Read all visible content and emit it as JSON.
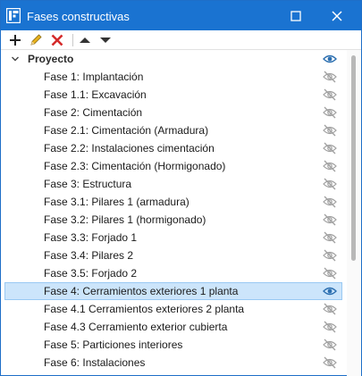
{
  "window": {
    "title": "Fases constructivas"
  },
  "toolbar": {
    "buttons": [
      {
        "name": "add-phase-button",
        "icon": "plus-icon"
      },
      {
        "name": "edit-phase-button",
        "icon": "pencil-icon"
      },
      {
        "name": "delete-phase-button",
        "icon": "red-x-icon"
      },
      {
        "name": "move-up-button",
        "icon": "triangle-up-icon"
      },
      {
        "name": "move-down-button",
        "icon": "triangle-down-icon"
      }
    ]
  },
  "colors": {
    "titlebar": "#1a73d1",
    "selection": "#cce5fb",
    "eye_visible": "#2c6fb0",
    "eye_hidden": "#a0a0a0"
  },
  "tree": {
    "root": {
      "label": "Proyecto",
      "expanded": true,
      "visible": true
    },
    "phases": [
      {
        "label": "Fase 1: Implantación",
        "visible": false,
        "selected": false
      },
      {
        "label": "Fase 1.1: Excavación",
        "visible": false,
        "selected": false
      },
      {
        "label": "Fase 2: Cimentación",
        "visible": false,
        "selected": false
      },
      {
        "label": "Fase 2.1: Cimentación (Armadura)",
        "visible": false,
        "selected": false
      },
      {
        "label": "Fase 2.2: Instalaciones cimentación",
        "visible": false,
        "selected": false
      },
      {
        "label": "Fase 2.3: Cimentación (Hormigonado)",
        "visible": false,
        "selected": false
      },
      {
        "label": "Fase 3: Estructura",
        "visible": false,
        "selected": false
      },
      {
        "label": "Fase 3.1: Pilares 1 (armadura)",
        "visible": false,
        "selected": false
      },
      {
        "label": "Fase 3.2: Pilares 1 (hormigonado)",
        "visible": false,
        "selected": false
      },
      {
        "label": "Fase 3.3: Forjado 1",
        "visible": false,
        "selected": false
      },
      {
        "label": "Fase 3.4: Pilares 2",
        "visible": false,
        "selected": false
      },
      {
        "label": "Fase 3.5: Forjado 2",
        "visible": false,
        "selected": false
      },
      {
        "label": "Fase 4: Cerramientos exteriores 1 planta",
        "visible": true,
        "selected": true
      },
      {
        "label": "Fase 4.1 Cerramientos exteriores 2 planta",
        "visible": false,
        "selected": false
      },
      {
        "label": "Fase 4.3 Cerramiento exterior cubierta",
        "visible": false,
        "selected": false
      },
      {
        "label": "Fase 5: Particiones interiores",
        "visible": false,
        "selected": false
      },
      {
        "label": "Fase 6: Instalaciones",
        "visible": false,
        "selected": false
      }
    ]
  }
}
